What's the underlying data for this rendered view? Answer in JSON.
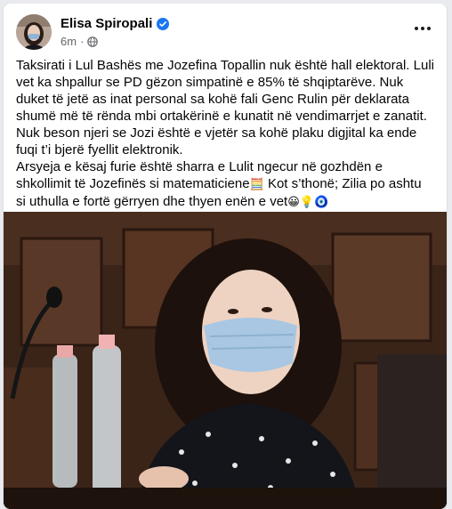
{
  "post": {
    "author": "Elisa Spiropali",
    "time": "6m",
    "dot": "·",
    "paragraphs": [
      "Taksirati i Lul Bashës me Jozefina Topallin nuk është hall elektoral. Luli vet ka shpallur se PD gëzon simpatinë e 85% të shqiptarëve. Nuk duket të jetë as inat personal sa kohë fali Genc Rulin për deklarata shumë më të rënda mbi ortakërinë e kunatit në vendimarrjet e zanatit.",
      "Nuk beson njeri se Jozi është e vjetër sa kohë plaku digjital ka ende fuqi t’i bjerë fyellit elektronik."
    ],
    "p3_part1": "Arsyeja e kësaj furie është sharra e Lulit ngecur në gozhdën e shkollimit të Jozefinës si matematiciene",
    "p3_emoji1": "🧮",
    "p3_part2": " Kot s’thonë; Zilia po ashtu si uthulla e fortë gërryen dhe thyen enën e vet",
    "p3_emojis": "😀💡🧿"
  },
  "colors": {
    "verified": "#1877f2",
    "text": "#050505",
    "secondary": "#65676b"
  },
  "icons": [
    "verified-badge-icon",
    "globe-icon",
    "more-options-icon"
  ]
}
